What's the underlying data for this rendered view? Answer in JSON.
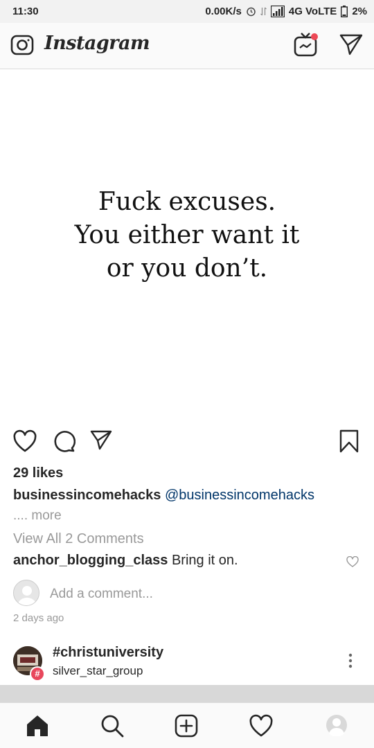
{
  "status_bar": {
    "time": "11:30",
    "speed": "0.00K/s",
    "network": "4G VoLTE",
    "battery": "2%"
  },
  "header": {
    "title": "Instagram"
  },
  "post": {
    "image_text_lines": [
      "Fuck excuses.",
      "You either want it",
      "or you don’t."
    ],
    "likes": "29 likes",
    "caption_user": "businessincomehacks",
    "caption_text": "@businessincomehacks",
    "more_label": ".... more",
    "view_comments": "View All 2 Comments",
    "comment_user": "anchor_blogging_class",
    "comment_text": "Bring it on.",
    "add_comment_placeholder": "Add a comment...",
    "timestamp": "2 days ago"
  },
  "next_post": {
    "hashtag": "#christuniversity",
    "username": "silver_star_group",
    "badge": "#"
  },
  "colors": {
    "notification_dot": "#ed4956",
    "mention": "#003569",
    "muted_text": "#999999"
  }
}
